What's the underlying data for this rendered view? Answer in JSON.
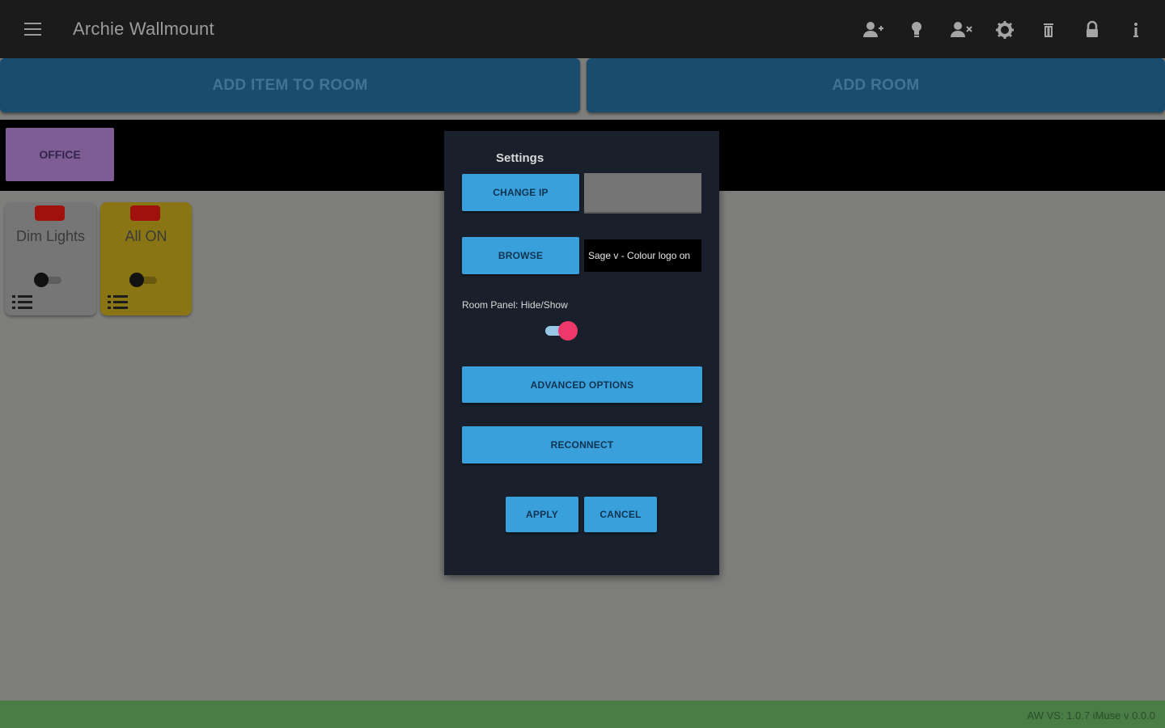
{
  "appbar": {
    "title": "Archie Wallmount",
    "icons": [
      "menu-icon",
      "add-user-icon",
      "lightbulb-icon",
      "remove-user-icon",
      "gear-icon",
      "trash-icon",
      "lock-icon",
      "info-icon"
    ]
  },
  "actions": {
    "add_item": "ADD ITEM TO ROOM",
    "add_room": "ADD ROOM"
  },
  "rooms": {
    "active": "OFFICE"
  },
  "cards": [
    {
      "label": "Dim Lights",
      "color": "#767676",
      "on": false
    },
    {
      "label": "All ON",
      "color": "#8a7514",
      "on": false
    }
  ],
  "dialog": {
    "title": "Settings",
    "change_ip": "CHANGE IP",
    "ip_value": "",
    "browse": "BROWSE",
    "browse_value": "Sage v - Colour logo on",
    "room_panel_label": "Room Panel: Hide/Show",
    "room_panel_on": true,
    "advanced": "ADVANCED OPTIONS",
    "reconnect": "RECONNECT",
    "apply": "APPLY",
    "cancel": "CANCEL"
  },
  "footer": {
    "version": "AW VS: 1.0.7  iMuse v 0.0.0"
  },
  "colors": {
    "appbar": "#1b1b1b",
    "action_button": "#1a4c6e",
    "room_tab": "#7d5d93",
    "dialog_bg": "#1a202b",
    "dialog_button": "#3aa0dc",
    "toggle_on": "#ee3869",
    "footer": "#4a7d45",
    "led_red": "#a0100d"
  }
}
